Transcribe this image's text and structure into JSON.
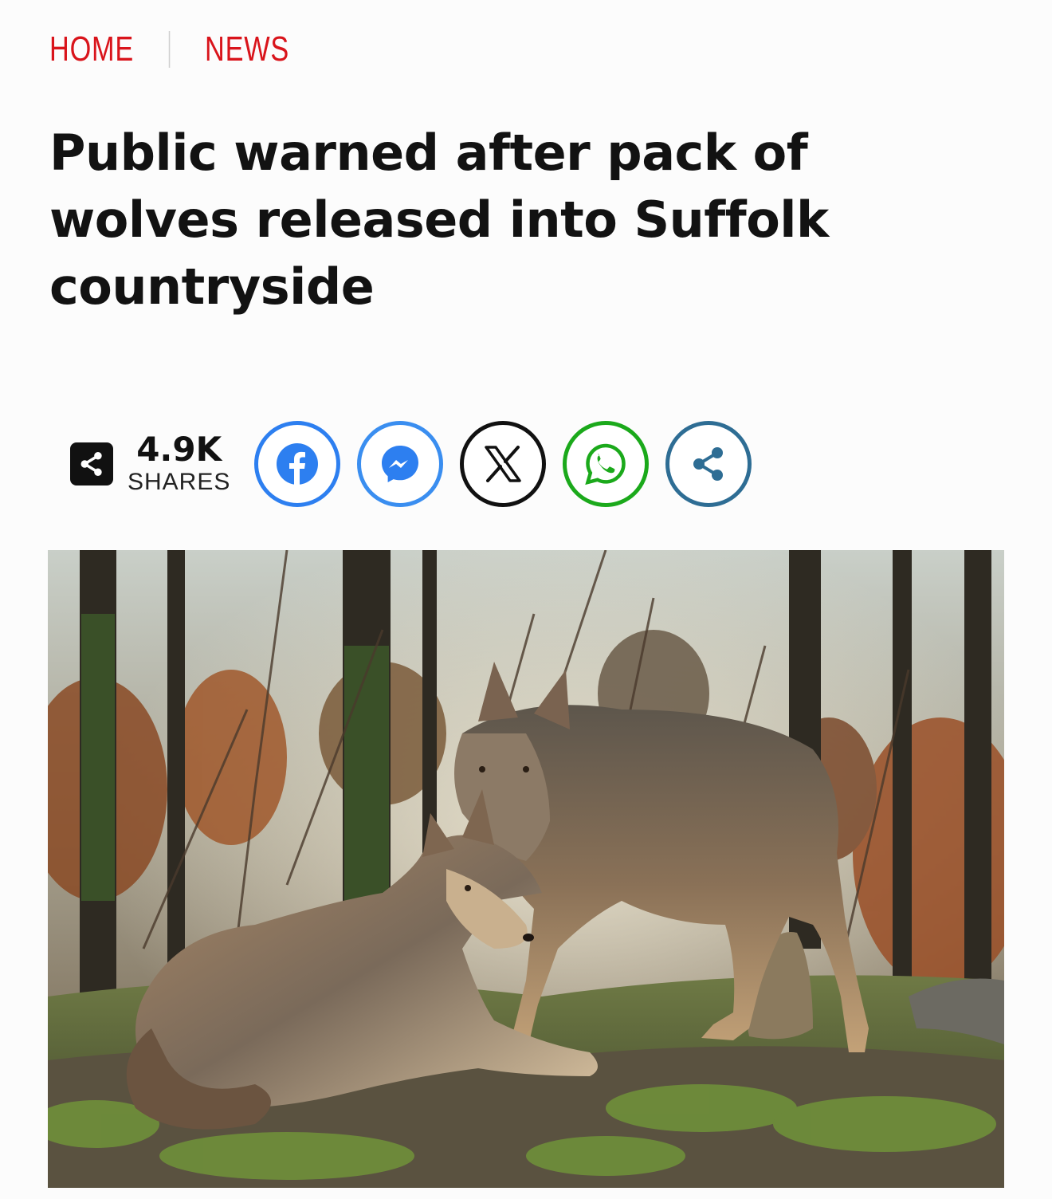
{
  "breadcrumb": {
    "items": [
      "HOME",
      "NEWS"
    ],
    "color": "#d9141b"
  },
  "article": {
    "headline": "Public warned after pack of wolves released into Suffolk countryside"
  },
  "share": {
    "count": "4.9K",
    "label": "SHARES",
    "buttons": [
      {
        "name": "facebook",
        "icon": "facebook-icon",
        "color": "#2d7ff0"
      },
      {
        "name": "messenger",
        "icon": "messenger-icon",
        "color": "#3a8ef0"
      },
      {
        "name": "x",
        "icon": "x-icon",
        "color": "#111111"
      },
      {
        "name": "whatsapp",
        "icon": "whatsapp-icon",
        "color": "#1ba91b"
      },
      {
        "name": "share",
        "icon": "share-icon",
        "color": "#2e6d94"
      }
    ]
  },
  "hero_image": {
    "subject": "two-wolves-in-forest-photo"
  }
}
